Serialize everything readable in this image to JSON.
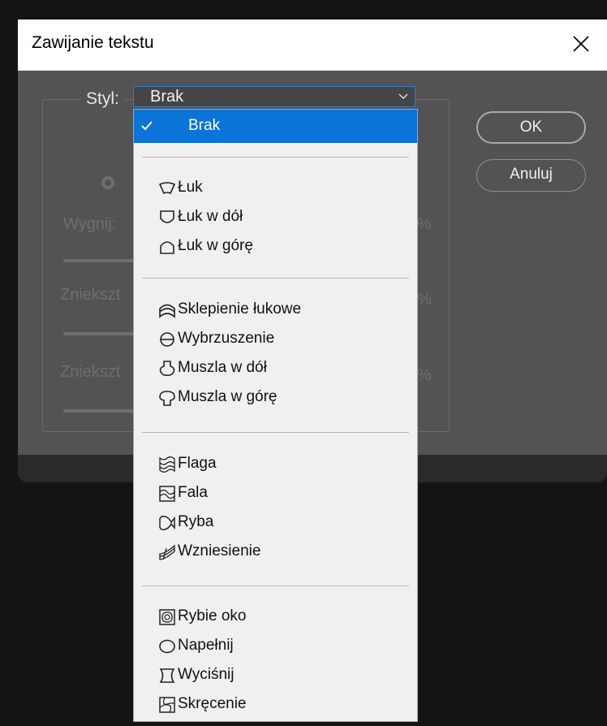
{
  "dialog": {
    "title": "Zawijanie tekstu",
    "style_label": "Styl:",
    "selected_style": "Brak",
    "ok_label": "OK",
    "cancel_label": "Anuluj",
    "faded_labels": {
      "bend": "Wygnij:",
      "hdistort": "Zniekszt",
      "vdistort": "Zniekszt",
      "percent": "%"
    }
  },
  "dropdown": {
    "selected": "Brak",
    "groups": [
      [
        {
          "label": "Łuk",
          "icon": "arc-icon"
        },
        {
          "label": "Łuk w dół",
          "icon": "arc-lower-icon"
        },
        {
          "label": "Łuk w górę",
          "icon": "arc-upper-icon"
        }
      ],
      [
        {
          "label": "Sklepienie łukowe",
          "icon": "arch-icon"
        },
        {
          "label": "Wybrzuszenie",
          "icon": "bulge-icon"
        },
        {
          "label": "Muszla w dół",
          "icon": "shell-lower-icon"
        },
        {
          "label": "Muszla w górę",
          "icon": "shell-upper-icon"
        }
      ],
      [
        {
          "label": "Flaga",
          "icon": "flag-icon"
        },
        {
          "label": "Fala",
          "icon": "wave-icon"
        },
        {
          "label": "Ryba",
          "icon": "fish-icon"
        },
        {
          "label": "Wzniesienie",
          "icon": "rise-icon"
        }
      ],
      [
        {
          "label": "Rybie oko",
          "icon": "fisheye-icon"
        },
        {
          "label": "Napełnij",
          "icon": "inflate-icon"
        },
        {
          "label": "Wyciśnij",
          "icon": "squeeze-icon"
        },
        {
          "label": "Skręcenie",
          "icon": "twist-icon"
        }
      ]
    ]
  },
  "colors": {
    "dialog_bg": "#535353",
    "highlight": "#0a74d8",
    "menu_bg": "#f0f0f0"
  }
}
